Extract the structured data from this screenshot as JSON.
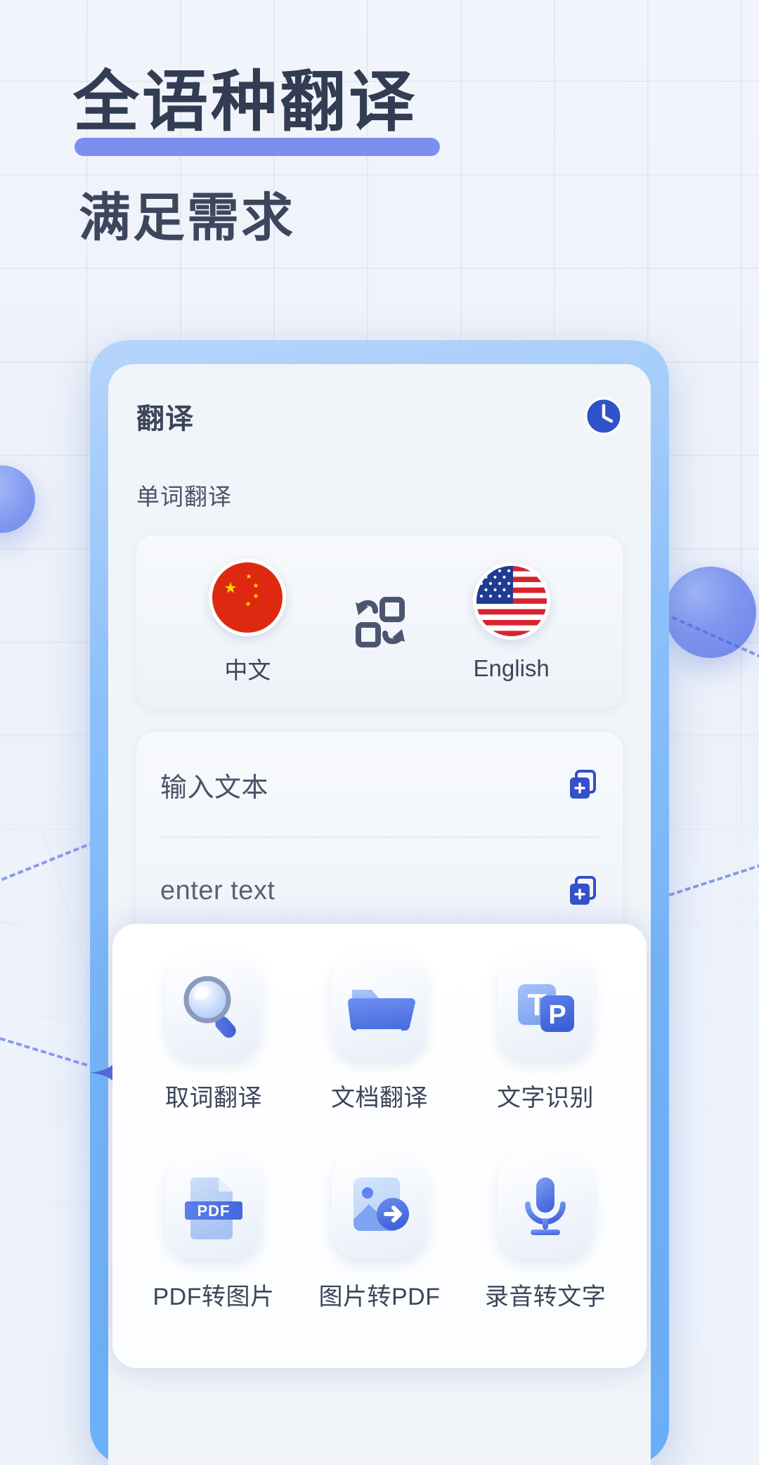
{
  "hero": {
    "headline": "全语种翻译",
    "subheadline": "满足需求",
    "underline_color": "#7b8fef",
    "text_color": "#323c52"
  },
  "phone": {
    "frame_color": "#7ab6f8",
    "screen_bg": "#f1f5f9",
    "app_bar": {
      "title": "翻译",
      "history_icon": "clock-history-icon"
    },
    "section_label": "单词翻译",
    "language_card": {
      "source": {
        "flag": "flag-china-icon",
        "name": "中文"
      },
      "swap_icon": "swap-languages-icon",
      "target": {
        "flag": "flag-usa-icon",
        "name": "English"
      }
    },
    "text_card": {
      "source_placeholder": "输入文本",
      "target_placeholder": "enter text",
      "copy_icon": "copy-add-icon"
    }
  },
  "sheet": {
    "tools": [
      {
        "label": "取词翻译",
        "icon": "magnifier-icon"
      },
      {
        "label": "文档翻译",
        "icon": "folder-icon"
      },
      {
        "label": "文字识别",
        "icon": "text-recognition-icon"
      },
      {
        "label": "PDF转图片",
        "icon": "pdf-file-icon"
      },
      {
        "label": "图片转PDF",
        "icon": "image-to-pdf-icon"
      },
      {
        "label": "录音转文字",
        "icon": "microphone-icon"
      }
    ]
  },
  "decor": {
    "accent_blue": "#6c84e8",
    "dash_color": "#4f67d8",
    "sparkle_icon": "sparkle-icon"
  }
}
